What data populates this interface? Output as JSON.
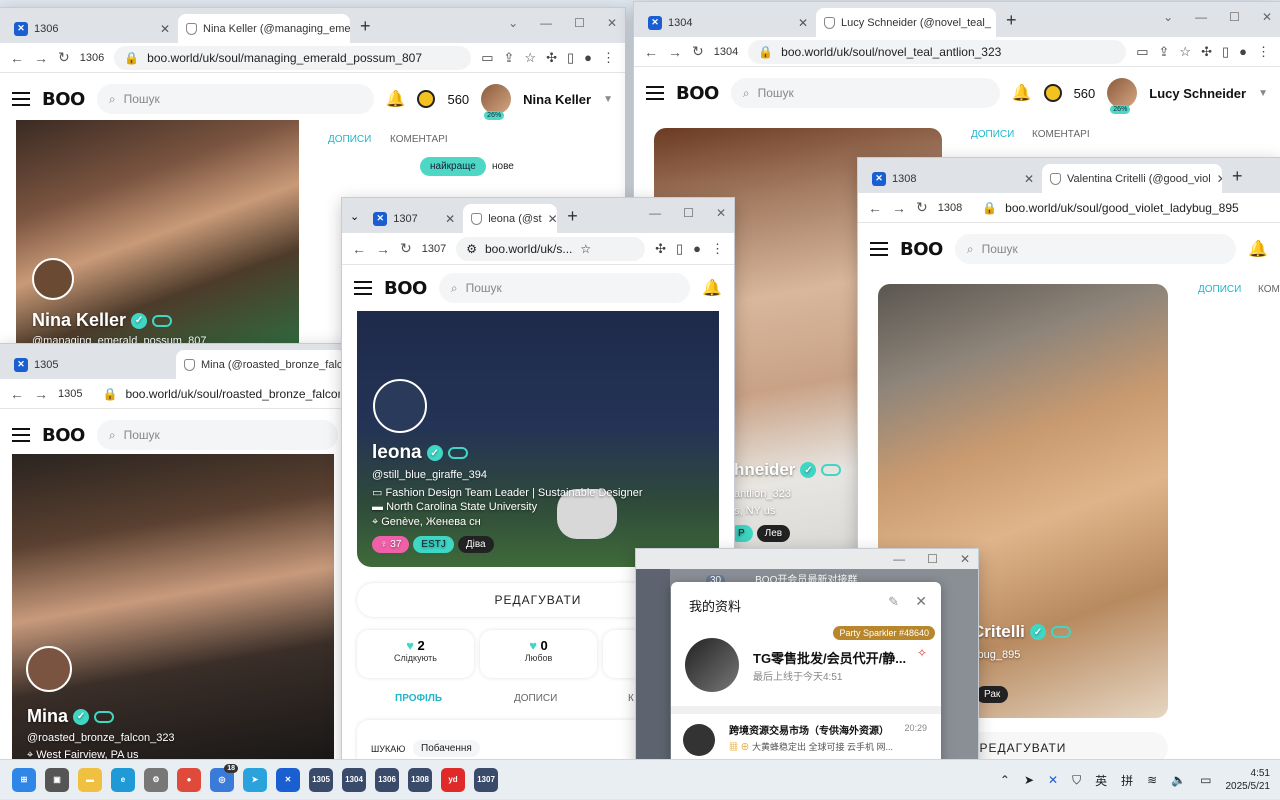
{
  "w1": {
    "tab1": "1306",
    "tab2": "Nina Keller (@managing_eme",
    "num": "1306",
    "url": "boo.world/uk/soul/managing_emerald_possum_807",
    "search": "Пошук",
    "coins": "560",
    "pct": "26%",
    "user": "Nina Keller",
    "name": "Nina Keller",
    "handle": "@managing_emerald_possum_807",
    "t1": "ДОПИСИ",
    "t2": "КОМЕНТАРІ",
    "p1": "найкраще",
    "p2": "нове"
  },
  "w2": {
    "tab1": "1304",
    "tab2": "Lucy Schneider (@novel_teal_",
    "num": "1304",
    "url": "boo.world/uk/soul/novel_teal_antlion_323",
    "search": "Пошук",
    "coins": "560",
    "pct": "26%",
    "user": "Lucy Schneider",
    "name": "hneider",
    "handle": "antlion_323",
    "loc": "s, NY us",
    "chip1": "P",
    "chip2": "Лев",
    "t1": "ДОПИСИ",
    "t2": "КОМЕНТАРІ"
  },
  "w3": {
    "tab1": "1308",
    "tab2": "Valentina Critelli (@good_viol",
    "num": "1308",
    "url": "boo.world/uk/soul/good_violet_ladybug_895",
    "search": "Пошук",
    "name": "Critelli",
    "handle": "ybug_895",
    "loc": "s",
    "chip": "Рак",
    "t1": "ДОПИСИ",
    "t2": "КОМ",
    "edit": "РЕДАГУВАТИ"
  },
  "w4": {
    "tab1": "1305",
    "tab2": "Mina (@roasted_bronze_falcon",
    "num": "1305",
    "url": "boo.world/uk/soul/roasted_bronze_falcon_3",
    "search": "Пошук",
    "name": "Mina",
    "handle": "@roasted_bronze_falcon_323",
    "loc": "West Fairview, PA us"
  },
  "w5": {
    "tab1": "1307",
    "tab2": "leona (@st",
    "num": "1307",
    "url": "boo.world/uk/s...",
    "search": "Пошук",
    "name": "leona",
    "handle": "@still_blue_giraffe_394",
    "job": "Fashion Design Team Leader | Sustainable Designer",
    "edu": "North Carolina State University",
    "loc": "Genève, Женева сн",
    "chip1": "37",
    "chip2": "ESTJ",
    "chip3": "Діва",
    "edit": "РЕДАГУВАТИ",
    "stat1v": "2",
    "stat1l": "Слідкують",
    "stat2v": "0",
    "stat2l": "Любов",
    "tab_profile": "ПРОФІЛЬ",
    "tab_posts": "ДОПИСИ",
    "tab_k": "К",
    "shukaiu": "ШУКАЮ",
    "pobach": "Побачення"
  },
  "tg": {
    "title": "我的资料",
    "badge": "Party Sparkler #48640",
    "pname": "TG零售批发/会员代开/静...",
    "last": "最后上线于今天4:51",
    "chat_name": "跨境资源交易市场（专供海外资源）",
    "chat_time": "20:29",
    "chat_msg": "大黄蜂稳定出 全球可接 云手机 网...",
    "bg_title": "BOO开会员最新对接群",
    "bg_count": "30"
  },
  "taskbar": {
    "b1": "1305",
    "b2": "1304",
    "b3": "1306",
    "b4": "1308",
    "b5": "1307",
    "badge": "18",
    "tray1": "英",
    "tray2": "拼",
    "time": "4:51",
    "date": "2025/5/21"
  },
  "colors": {
    "accent": "#3fd6c4",
    "blue_link": "#22b5c9",
    "brand": "#1a5fd1"
  }
}
